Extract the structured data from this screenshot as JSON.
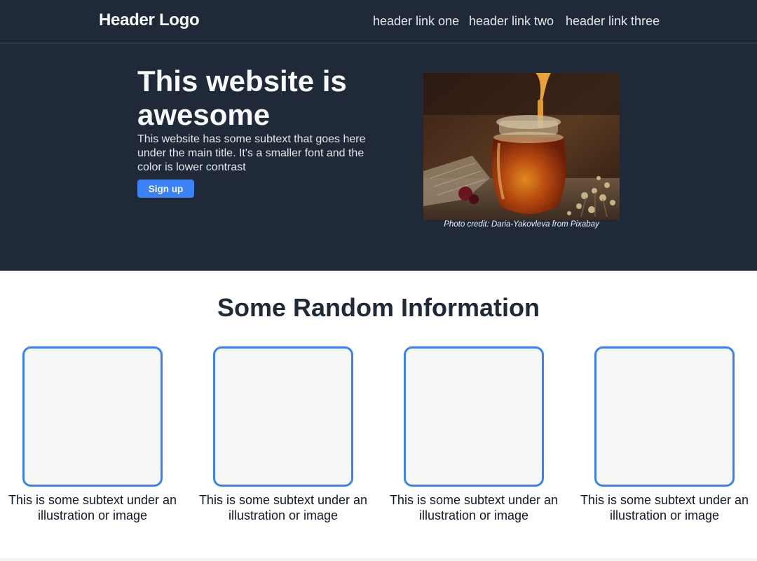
{
  "header": {
    "logo": "Header Logo",
    "links": [
      "header link one",
      "header link two",
      "header link three"
    ]
  },
  "hero": {
    "title": "This website is awesome",
    "subtitle": "This website has some subtext that goes here under the main title. It's a smaller font and the color is lower contrast",
    "button_label": "Sign up",
    "image_alt": "Jar of honey with honey dripping from a dipper",
    "photo_credit": "Photo credit: Daria-Yakovleva from Pixabay"
  },
  "info": {
    "title": "Some Random Information",
    "items": [
      {
        "text": "This is some subtext under an illustration or image"
      },
      {
        "text": "This is some subtext under an illustration or image"
      },
      {
        "text": "This is some subtext under an illustration or image"
      },
      {
        "text": "This is some subtext under an illustration or image"
      }
    ]
  },
  "colors": {
    "header_bg": "#1f2937",
    "accent": "#3b82f6",
    "text_light": "#f9fafb",
    "text_dark": "#1f2937"
  }
}
